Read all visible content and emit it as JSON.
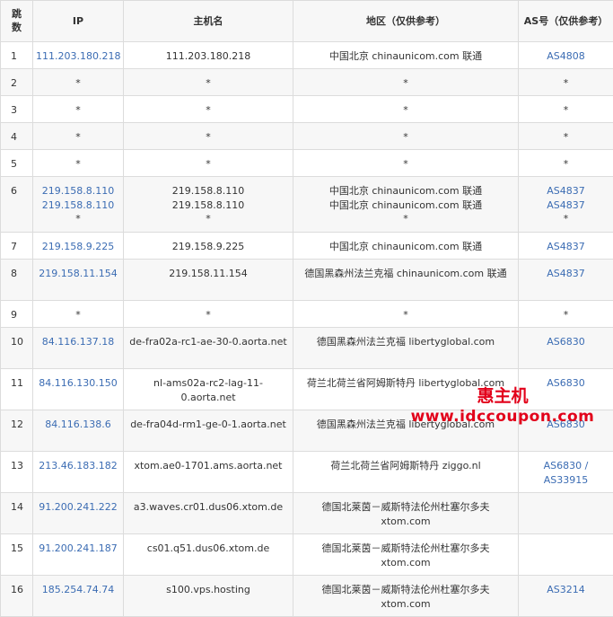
{
  "headers": {
    "hop": "跳数",
    "ip": "IP",
    "host": "主机名",
    "region": "地区（仅供参考）",
    "as": "AS号（仅供参考）"
  },
  "rows": [
    {
      "hop": "1",
      "ip": [
        "111.203.180.218"
      ],
      "host": [
        "111.203.180.218"
      ],
      "region": [
        "中国北京 chinaunicom.com 联通"
      ],
      "as": [
        "AS4808"
      ],
      "h": 30
    },
    {
      "hop": "2",
      "ip": [
        "*"
      ],
      "host": [
        "*"
      ],
      "region": [
        "*"
      ],
      "as": [
        "*"
      ],
      "h": 30
    },
    {
      "hop": "3",
      "ip": [
        "*"
      ],
      "host": [
        "*"
      ],
      "region": [
        "*"
      ],
      "as": [
        "*"
      ],
      "h": 30
    },
    {
      "hop": "4",
      "ip": [
        "*"
      ],
      "host": [
        "*"
      ],
      "region": [
        "*"
      ],
      "as": [
        "*"
      ],
      "h": 30
    },
    {
      "hop": "5",
      "ip": [
        "*"
      ],
      "host": [
        "*"
      ],
      "region": [
        "*"
      ],
      "as": [
        "*"
      ],
      "h": 30
    },
    {
      "hop": "6",
      "ip": [
        "219.158.8.110",
        "219.158.8.110",
        "*"
      ],
      "host": [
        "219.158.8.110",
        "219.158.8.110",
        "*"
      ],
      "region": [
        "中国北京 chinaunicom.com 联通",
        "中国北京 chinaunicom.com 联通",
        "*"
      ],
      "as": [
        "AS4837",
        "AS4837",
        "*"
      ],
      "h": 62
    },
    {
      "hop": "7",
      "ip": [
        "219.158.9.225"
      ],
      "host": [
        "219.158.9.225"
      ],
      "region": [
        "中国北京 chinaunicom.com 联通"
      ],
      "as": [
        "AS4837"
      ],
      "h": 30
    },
    {
      "hop": "8",
      "ip": [
        "219.158.11.154"
      ],
      "host": [
        "219.158.11.154"
      ],
      "region": [
        "德国黑森州法兰克福 chinaunicom.com 联通"
      ],
      "as": [
        "AS4837"
      ],
      "h": 46
    },
    {
      "hop": "9",
      "ip": [
        "*"
      ],
      "host": [
        "*"
      ],
      "region": [
        "*"
      ],
      "as": [
        "*"
      ],
      "h": 30
    },
    {
      "hop": "10",
      "ip": [
        "84.116.137.18"
      ],
      "host": [
        "de-fra02a-rc1-ae-30-0.aorta.net"
      ],
      "region": [
        "德国黑森州法兰克福 libertyglobal.com"
      ],
      "as": [
        "AS6830"
      ],
      "h": 46
    },
    {
      "hop": "11",
      "ip": [
        "84.116.130.150"
      ],
      "host": [
        "nl-ams02a-rc2-lag-11-",
        "0.aorta.net"
      ],
      "region": [
        "荷兰北荷兰省阿姆斯特丹 libertyglobal.com"
      ],
      "as": [
        "AS6830"
      ],
      "h": 46
    },
    {
      "hop": "12",
      "ip": [
        "84.116.138.6"
      ],
      "host": [
        "de-fra04d-rm1-ge-0-1.aorta.net"
      ],
      "region": [
        "德国黑森州法兰克福 libertyglobal.com"
      ],
      "as": [
        "AS6830"
      ],
      "h": 46
    },
    {
      "hop": "13",
      "ip": [
        "213.46.183.182"
      ],
      "host": [
        "xtom.ae0-1701.ams.aorta.net"
      ],
      "region": [
        "荷兰北荷兰省阿姆斯特丹 ziggo.nl"
      ],
      "as": [
        "AS6830 /",
        "AS33915"
      ],
      "h": 46
    },
    {
      "hop": "14",
      "ip": [
        "91.200.241.222"
      ],
      "host": [
        "a3.waves.cr01.dus06.xtom.de"
      ],
      "region": [
        "德国北莱茵－威斯特法伦州杜塞尔多夫",
        "xtom.com"
      ],
      "as": [],
      "h": 46
    },
    {
      "hop": "15",
      "ip": [
        "91.200.241.187"
      ],
      "host": [
        "cs01.q51.dus06.xtom.de"
      ],
      "region": [
        "德国北莱茵－威斯特法伦州杜塞尔多夫",
        "xtom.com"
      ],
      "as": [],
      "h": 46
    },
    {
      "hop": "16",
      "ip": [
        "185.254.74.74"
      ],
      "host": [
        "s100.vps.hosting"
      ],
      "region": [
        "德国北莱茵－威斯特法伦州杜塞尔多夫",
        "xtom.com"
      ],
      "as": [
        "AS3214"
      ],
      "h": 46
    }
  ],
  "watermark": {
    "line1": "惠主机",
    "line2": "www.idccoupon.com"
  },
  "colors": {
    "link": "#3b6cb3",
    "header_bg": "#f7f7f7",
    "stripe": "#f7f7f7",
    "border": "#dcdcdc",
    "watermark": "#e2001a"
  }
}
